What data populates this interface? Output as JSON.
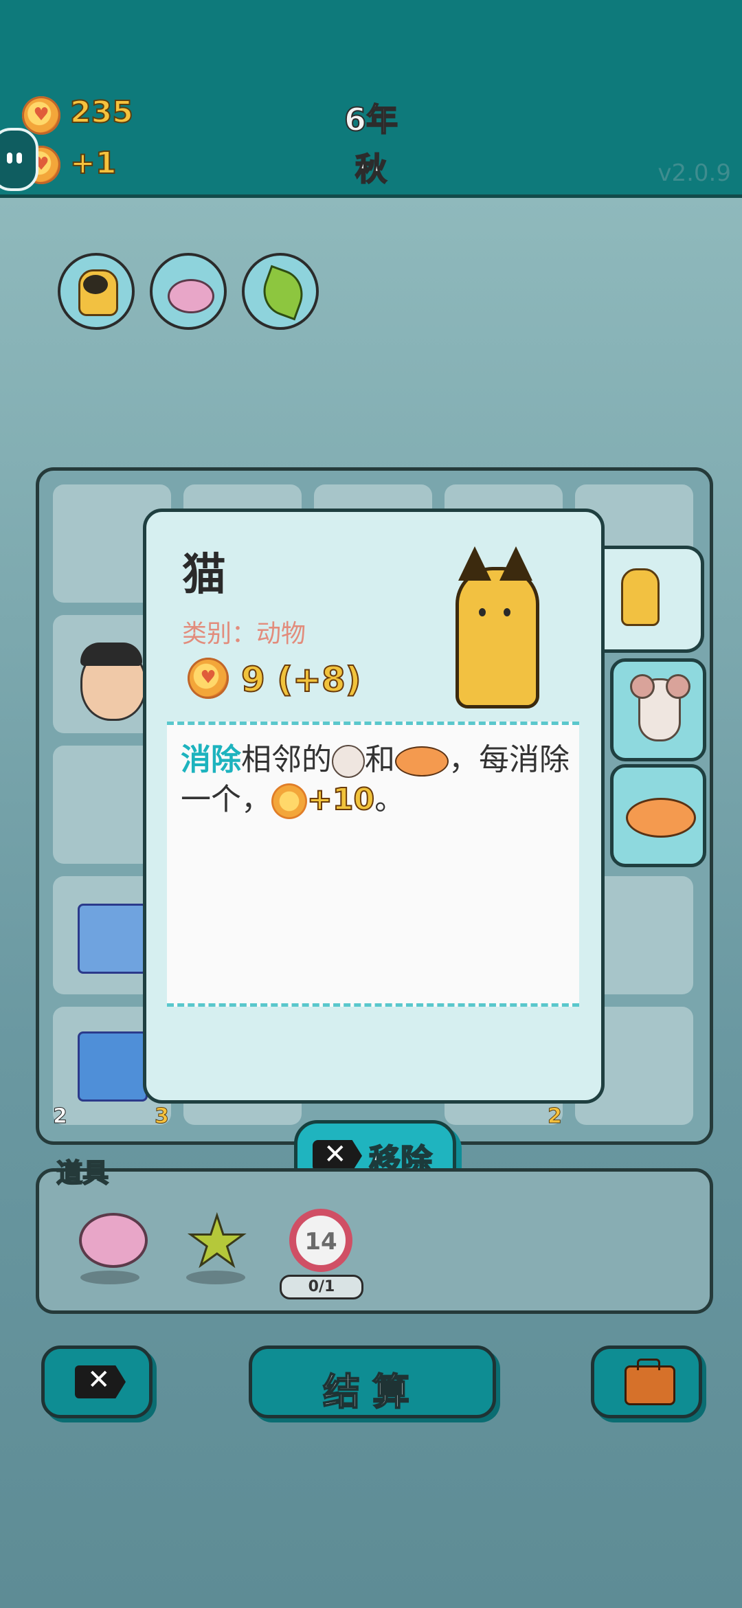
{
  "header": {
    "coins": "235",
    "income": "+1",
    "year": "6年",
    "season": "秋",
    "version": "v2.0.9"
  },
  "board_counts": [
    "2",
    "3",
    "2"
  ],
  "tooltip": {
    "name": "猫",
    "category": "类别：动物",
    "value": "9 (+8)",
    "desc_highlight": "消除",
    "desc_part1": "相邻的",
    "desc_part2": "和",
    "desc_part3": "，每消除一个，",
    "desc_bonus": "+10",
    "desc_end": "。"
  },
  "remove_button": "移除",
  "props": {
    "label": "道具",
    "counter": "14",
    "progress": "0/1"
  },
  "bottom": {
    "settle_label": "结算"
  },
  "colors": {
    "header_bg": "#0e7a7b",
    "accent": "#1fb4bf",
    "coin_text": "#f6c23d"
  }
}
